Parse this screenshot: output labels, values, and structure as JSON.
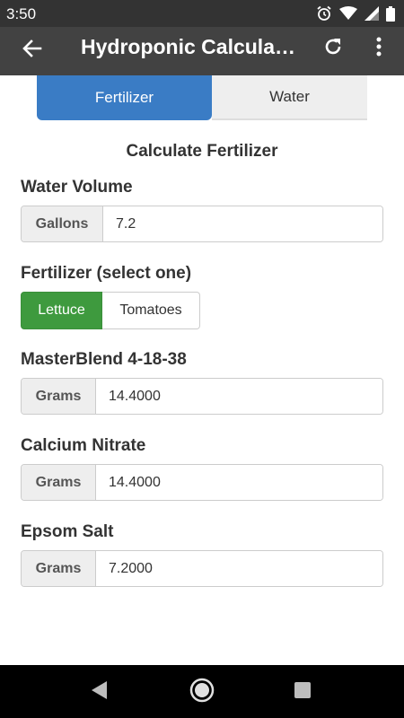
{
  "status_bar": {
    "time": "3:50",
    "icons": [
      "alarm-icon",
      "wifi-icon",
      "signal-icon",
      "battery-icon"
    ]
  },
  "app_bar": {
    "title": "Hydroponic Calcula…",
    "icons": [
      "back-arrow-icon",
      "refresh-icon",
      "more-vert-icon"
    ]
  },
  "tabs": [
    {
      "label": "Fertilizer",
      "active": true
    },
    {
      "label": "Water",
      "active": false
    }
  ],
  "section_title": "Calculate Fertilizer",
  "water_volume": {
    "label": "Water Volume",
    "unit": "Gallons",
    "value": "7.2"
  },
  "fertilizer_select": {
    "label": "Fertilizer (select one)",
    "options": [
      {
        "label": "Lettuce",
        "selected": true
      },
      {
        "label": "Tomatoes",
        "selected": false
      }
    ]
  },
  "results": [
    {
      "label": "MasterBlend 4-18-38",
      "unit": "Grams",
      "value": "14.4000"
    },
    {
      "label": "Calcium Nitrate",
      "unit": "Grams",
      "value": "14.4000"
    },
    {
      "label": "Epsom Salt",
      "unit": "Grams",
      "value": "7.2000"
    }
  ],
  "nav_bar": {
    "icons": [
      "back-triangle-icon",
      "home-circle-icon",
      "recents-square-icon"
    ]
  },
  "colors": {
    "status_bar": "#333333",
    "app_bar": "#424242",
    "tab_active": "#3a7cc5",
    "toggle_selected": "#3e9a3e",
    "addon_bg": "#eeeeee"
  }
}
